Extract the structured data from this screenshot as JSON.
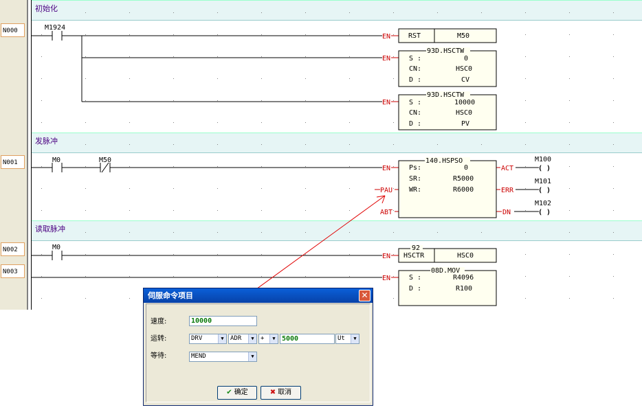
{
  "comments": {
    "c1": "初始化",
    "c2": "发脉冲",
    "c3": "读取脉冲"
  },
  "networks": [
    "N000",
    "N001",
    "N002",
    "N003"
  ],
  "contacts": {
    "m1924": "M1924",
    "m0a": "M0",
    "m50": "M50",
    "m0b": "M0"
  },
  "pins": {
    "en": "EN",
    "pau": "PAU",
    "abt": "ABT",
    "act": "ACT",
    "err": "ERR",
    "dn": "DN"
  },
  "coils": {
    "m100": "M100",
    "m101": "M101",
    "m102": "M102",
    "symbol": "( )"
  },
  "rst_block": {
    "op": "RST",
    "arg": "M50"
  },
  "hsctw1": {
    "title": "93D.HSCTW",
    "s_label": "S :",
    "s": "0",
    "cn_label": "CN:",
    "cn": "HSC0",
    "d_label": "D :",
    "d": "CV"
  },
  "hsctw2": {
    "title": "93D.HSCTW",
    "s_label": "S :",
    "s": "10000",
    "cn_label": "CN:",
    "cn": "HSC0",
    "d_label": "D :",
    "d": "PV"
  },
  "hspso": {
    "title": "140.HSPSO",
    "ps_label": "Ps:",
    "ps": "0",
    "sr_label": "SR:",
    "sr": "R5000",
    "wr_label": "WR:",
    "wr": "R6000"
  },
  "hsctr": {
    "num": "92",
    "op": "HSCTR",
    "arg": "HSC0"
  },
  "mov": {
    "title": "08D.MOV",
    "s_label": "S :",
    "s": "R4096",
    "d_label": "D :",
    "d": "R100"
  },
  "dialog": {
    "title": "伺服命令项目",
    "speed_label": "速度:",
    "speed_value": "10000",
    "run_label": "运转:",
    "run_cmd": "DRV",
    "run_axis": "ADR",
    "run_sign": "+",
    "run_value": "5000",
    "run_unit": "Ut",
    "wait_label": "等待:",
    "wait_value": "MEND",
    "ok_label": "确定",
    "cancel_label": "取消"
  },
  "colors": {
    "pin_red": "#cc0000",
    "value_green": "#0a7a0a",
    "comment_bg": "#e6f5f5",
    "title_blue": "#0842a8"
  }
}
